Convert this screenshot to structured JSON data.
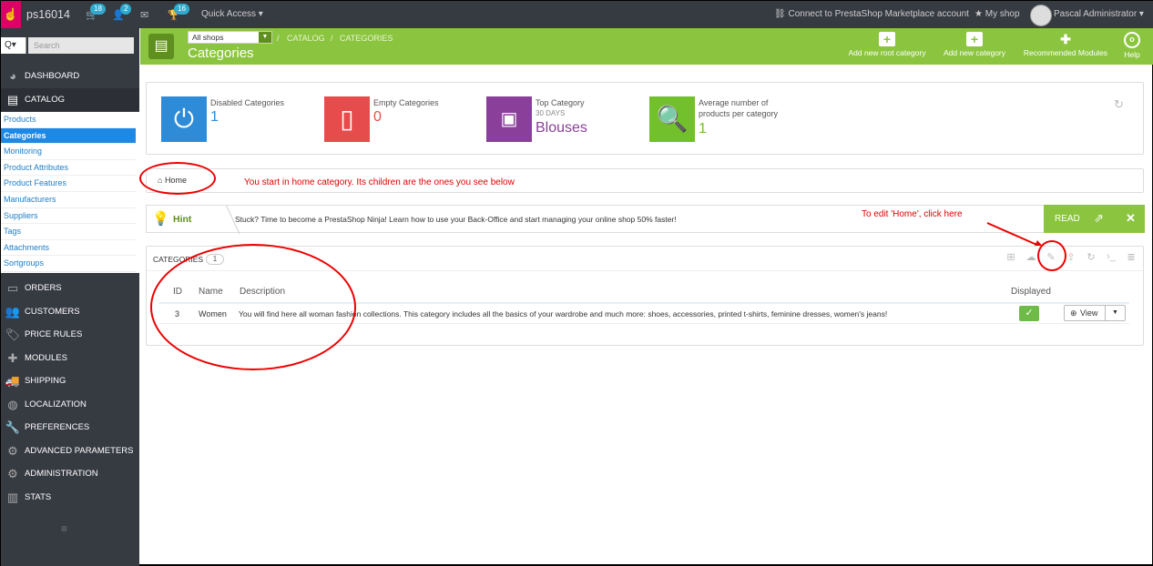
{
  "topbar": {
    "shop_name": "ps16014",
    "orders_badge": "18",
    "customers_badge": "2",
    "messages_badge": "16",
    "quick_access": "Quick Access ▾",
    "marketplace": "Connect to PrestaShop Marketplace account",
    "my_shop": "My shop",
    "user": "Pascal Administrator ▾"
  },
  "sidebar": {
    "search_button": "Q▾",
    "search_placeholder": "Search",
    "dashboard": "DASHBOARD",
    "catalog": "CATALOG",
    "submenu": [
      "Products",
      "Categories",
      "Monitoring",
      "Product Attributes",
      "Product Features",
      "Manufacturers",
      "Suppliers",
      "Tags",
      "Attachments",
      "Sortgroups"
    ],
    "items": [
      "ORDERS",
      "CUSTOMERS",
      "PRICE RULES",
      "MODULES",
      "SHIPPING",
      "LOCALIZATION",
      "PREFERENCES",
      "ADVANCED PARAMETERS",
      "ADMINISTRATION",
      "STATS"
    ],
    "collapse_icon": "≡"
  },
  "header": {
    "shop_select": "All shops",
    "crumb1": "CATALOG",
    "crumb2": "CATEGORIES",
    "title": "Categories",
    "btn_root": "Add new root category",
    "btn_cat": "Add new category",
    "btn_modules": "Recommended Modules",
    "btn_help": "Help"
  },
  "kpis": [
    {
      "label": "Disabled Categories",
      "value": "1",
      "color": "#2e8bd8"
    },
    {
      "label": "Empty Categories",
      "value": "0",
      "color": "#e64c4c"
    },
    {
      "label": "Top Category",
      "sub": "30 DAYS",
      "value": "Blouses",
      "color": "#8a3f9b"
    },
    {
      "label": "Average number of products per category",
      "value": "1",
      "color": "#72c02c"
    }
  ],
  "breadcrumb": {
    "home": "Home"
  },
  "notes": {
    "home_note": "You start in home category. Its children are the ones you see below",
    "edit_note": "To edit 'Home', click here"
  },
  "hint": {
    "label": "Hint",
    "text": "Stuck? Time to become a PrestaShop Ninja! Learn how to use your Back-Office and start managing your online shop 50% faster!",
    "read": "READ"
  },
  "categories": {
    "title": "CATEGORIES",
    "count": "1",
    "columns": {
      "id": "ID",
      "name": "Name",
      "description": "Description",
      "displayed": "Displayed"
    },
    "rows": [
      {
        "id": "3",
        "name": "Women",
        "description": "You will find here all woman fashion collections. This category includes all the basics of your wardrobe and much more: shoes, accessories, printed t-shirts, feminine dresses, women's jeans!",
        "displayed": "✓",
        "action": "View"
      }
    ]
  }
}
